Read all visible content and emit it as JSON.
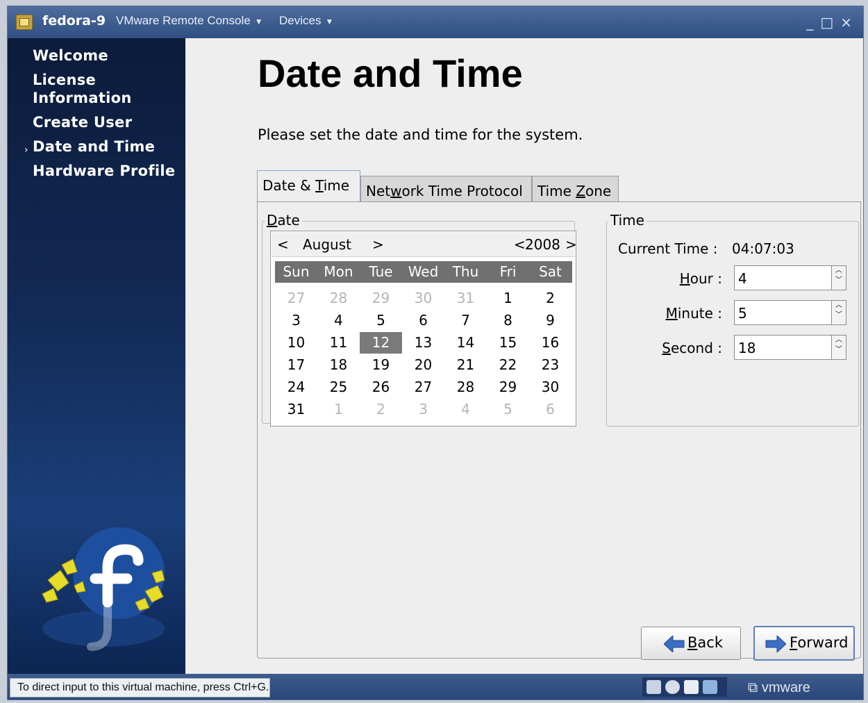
{
  "window": {
    "vm_name": "fedora-9",
    "menus": [
      "VMware Remote Console",
      "Devices"
    ],
    "controls": {
      "minimize": "_",
      "maximize": "□",
      "close": "×"
    }
  },
  "sidebar": {
    "items": [
      {
        "label": "Welcome"
      },
      {
        "label_line1": "License",
        "label_line2": "Information"
      },
      {
        "label": "Create User"
      },
      {
        "label": "Date and Time",
        "current": true
      },
      {
        "label": "Hardware Profile"
      }
    ]
  },
  "page": {
    "title": "Date and Time",
    "instructions": "Please set the date and time for the system."
  },
  "tabs": [
    {
      "pre": "Date & ",
      "key": "T",
      "post": "ime",
      "active": true
    },
    {
      "pre": "Net",
      "key": "w",
      "post": "ork Time Protocol",
      "active": false
    },
    {
      "pre": "Time ",
      "key": "Z",
      "post": "one",
      "active": false
    }
  ],
  "date_frame": {
    "label_key": "D",
    "label_rest": "ate",
    "calendar": {
      "month": "August",
      "year": "2008",
      "prev_month": "<",
      "next_month": ">",
      "prev_year": "<",
      "next_year": ">",
      "weekdays": [
        "Sun",
        "Mon",
        "Tue",
        "Wed",
        "Thu",
        "Fri",
        "Sat"
      ],
      "weeks": [
        [
          "27",
          "28",
          "29",
          "30",
          "31",
          "1",
          "2"
        ],
        [
          "3",
          "4",
          "5",
          "6",
          "7",
          "8",
          "9"
        ],
        [
          "10",
          "11",
          "12",
          "13",
          "14",
          "15",
          "16"
        ],
        [
          "17",
          "18",
          "19",
          "20",
          "21",
          "22",
          "23"
        ],
        [
          "24",
          "25",
          "26",
          "27",
          "28",
          "29",
          "30"
        ],
        [
          "31",
          "1",
          "2",
          "3",
          "4",
          "5",
          "6"
        ]
      ],
      "selected_day": "12"
    }
  },
  "time_frame": {
    "label": "Time",
    "current_time_label": "Current Time :",
    "current_time": "04:07:03",
    "hour": {
      "key": "H",
      "rest": "our :",
      "value": "4"
    },
    "minute": {
      "key": "M",
      "rest": "inute :",
      "value": "5"
    },
    "second": {
      "key": "S",
      "rest": "econd :",
      "value": "18"
    }
  },
  "buttons": {
    "back": {
      "key": "B",
      "rest": "ack"
    },
    "forward": {
      "key": "F",
      "rest": "orward"
    }
  },
  "statusbar": {
    "message": "To direct input to this virtual machine, press Ctrl+G.",
    "brand": "vmware"
  },
  "colors": {
    "titlebar": "#3d5c8f",
    "sidebar": "#12295a",
    "selected_day": "#7a7a7a",
    "weekday_bar": "#707070",
    "arrow_blue": "#3a6fc4"
  }
}
